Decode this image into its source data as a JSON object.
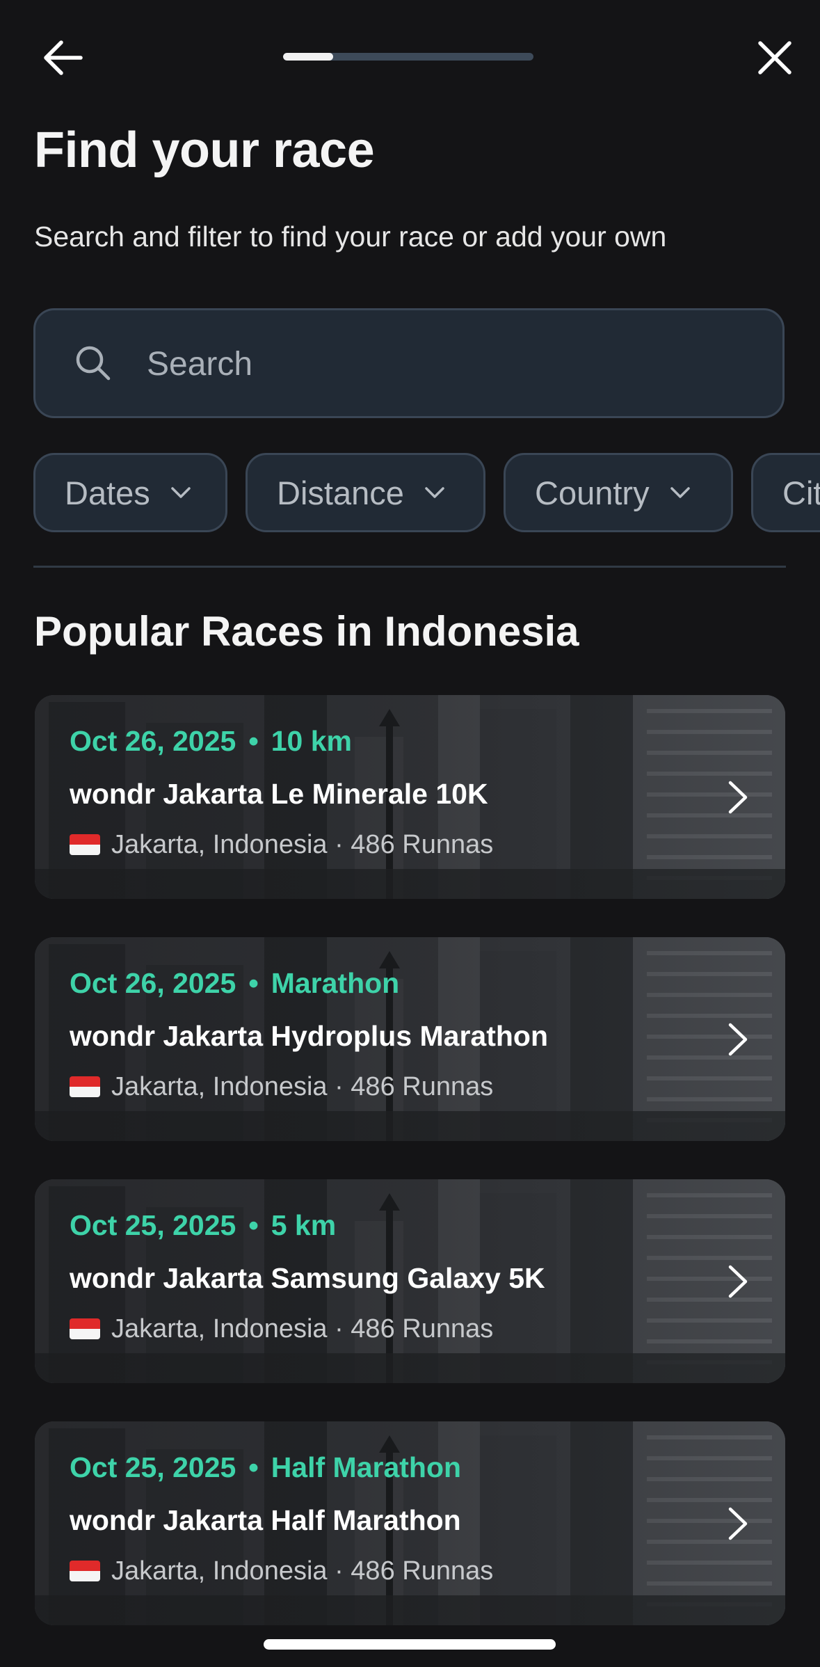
{
  "header": {
    "progress_fraction": 0.2
  },
  "page": {
    "title": "Find your race",
    "subtitle": "Search and filter to find your race or add your own"
  },
  "search": {
    "placeholder": "Search",
    "value": ""
  },
  "filters": [
    {
      "label": "Dates"
    },
    {
      "label": "Distance"
    },
    {
      "label": "Country"
    },
    {
      "label": "City"
    }
  ],
  "section": {
    "title": "Popular Races in Indonesia"
  },
  "races": [
    {
      "date": "Oct 26, 2025",
      "separator": "•",
      "distance": "10 km",
      "name": "wondr Jakarta Le Minerale 10K",
      "flag": "indonesia-flag",
      "location": "Jakarta, Indonesia · 486 Runnas"
    },
    {
      "date": "Oct 26, 2025",
      "separator": "•",
      "distance": "Marathon",
      "name": "wondr Jakarta Hydroplus Marathon",
      "flag": "indonesia-flag",
      "location": "Jakarta, Indonesia · 486 Runnas"
    },
    {
      "date": "Oct 25, 2025",
      "separator": "•",
      "distance": "5 km",
      "name": "wondr Jakarta Samsung Galaxy 5K",
      "flag": "indonesia-flag",
      "location": "Jakarta, Indonesia · 486 Runnas"
    },
    {
      "date": "Oct 25, 2025",
      "separator": "•",
      "distance": "Half Marathon",
      "name": "wondr Jakarta Half Marathon",
      "flag": "indonesia-flag",
      "location": "Jakarta, Indonesia · 486 Runnas"
    }
  ],
  "colors": {
    "background": "#141416",
    "accent": "#3ed3a9",
    "field_bg": "#212a35",
    "field_border": "#3a4655"
  },
  "icons": {
    "back": "arrow-left-icon",
    "close": "close-icon",
    "search": "search-icon",
    "chip_chevron": "chevron-down-icon",
    "card_chevron": "chevron-right-icon"
  }
}
